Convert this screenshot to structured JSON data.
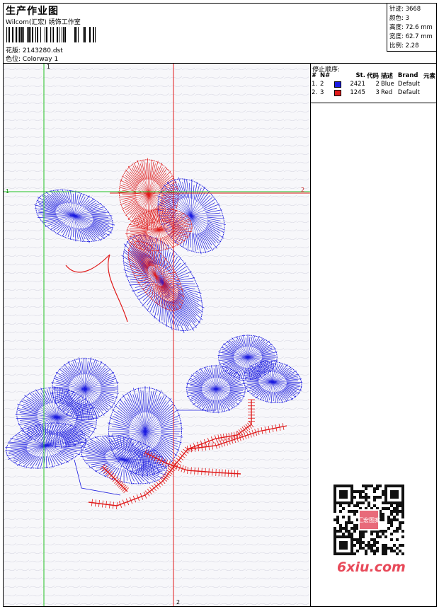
{
  "header": {
    "title": "生产作业图",
    "studio": "Wilcom(汇宏) 绣饰工作室",
    "design_label": "花版: 2143280.dst",
    "colorway_label": "色位: Colorway 1"
  },
  "stats": {
    "stitches": "针迹: 3668",
    "colors": "颜色: 3",
    "height": "高度: 72.6 mm",
    "width": "宽度: 62.7 mm",
    "scale": "比例: 2.28"
  },
  "stop_sequence": {
    "heading": "停止顺序:",
    "columns": [
      "#",
      "N#",
      "St.",
      "代码",
      "描述",
      "Brand",
      "元素"
    ],
    "rows": [
      {
        "idx": "1.",
        "n": "2",
        "color": "#1a1ae0",
        "st": "2421",
        "code": "2",
        "desc": "Blue",
        "brand": "Default",
        "elem": ""
      },
      {
        "idx": "2.",
        "n": "3",
        "color": "#e01a1a",
        "st": "1245",
        "code": "3",
        "desc": "Red",
        "brand": "Default",
        "elem": ""
      }
    ]
  },
  "guides": {
    "v1": "1",
    "h1_left": "1",
    "h1_right": "2",
    "v2_bottom": "2"
  },
  "watermark": {
    "site": "6xiu.com",
    "stamp": "汇宏图案"
  },
  "colors": {
    "blue": "#1a1ae0",
    "red": "#e01a1a",
    "guide_green": "#22c022",
    "guide_red": "#e01a1a"
  }
}
